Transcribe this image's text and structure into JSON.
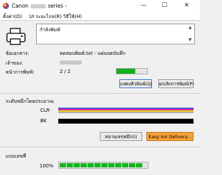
{
  "window": {
    "title_prefix": "Canon",
    "title_suffix": "series -",
    "minimize_glyph": "—",
    "maximize_glyph": "☐",
    "close_glyph": "✕"
  },
  "menu": [
    {
      "label": "ตั้งค่า(O)"
    },
    {
      "label": "UI ระยะไกล(R)"
    },
    {
      "label": "วิธีใช้(H)"
    }
  ],
  "status": {
    "message": "กำลังพิมพ์"
  },
  "info": {
    "document_label": "ข้อเอกสาร:",
    "document_value": "ทดสอบพิมพ์.txt - แผ่นจดบันทึก",
    "owner_label": "เจ้าของ:",
    "pages_label": "หน้าการพิมพ์:",
    "pages_value": "2 / 2",
    "page_progress": 0.62
  },
  "buttons": {
    "print_queue": "แสดงคิวพิมพ์(Q)",
    "cancel_print": "ยกเลิกการพิมพ์(P)",
    "ink_details": "หมายเลขหมึก(I)",
    "easy_ink": "Easy Ink Delivery..."
  },
  "ink": {
    "section_label": "ระดับหมึกโดยประมาณ",
    "cartridges": [
      {
        "name": "CLR",
        "colors": [
          "#3b4fd8",
          "#ef2a8e",
          "#e7d320",
          "#b0b0b0"
        ]
      },
      {
        "name": "BK",
        "colors": [
          "#000000"
        ]
      }
    ]
  },
  "progress_section": {
    "label": "แบบเลขที่",
    "percent_text": "100%",
    "percent": 1.0
  }
}
